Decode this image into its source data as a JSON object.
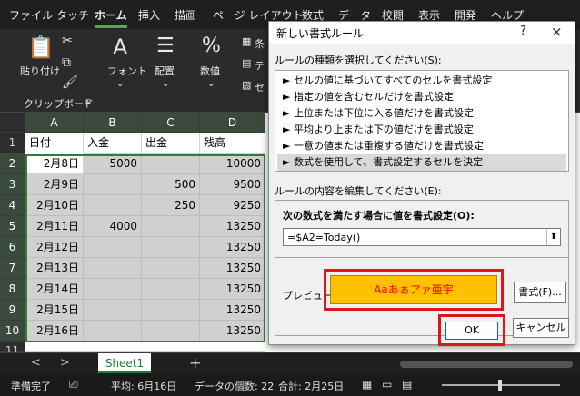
{
  "menu": {
    "tabs": [
      {
        "label": "ファイル",
        "active": false
      },
      {
        "label": "タッチ",
        "active": false
      },
      {
        "label": "ホーム",
        "active": true
      },
      {
        "label": "挿入",
        "active": false
      },
      {
        "label": "描画",
        "active": false
      },
      {
        "label": "ページ レイアウト",
        "active": false
      },
      {
        "label": "数式",
        "active": false
      },
      {
        "label": "データ",
        "active": false
      },
      {
        "label": "校閲",
        "active": false
      },
      {
        "label": "表示",
        "active": false
      },
      {
        "label": "開発",
        "active": false
      },
      {
        "label": "ヘルプ",
        "active": false
      }
    ]
  },
  "ribbon": {
    "paste_label": "貼り付け",
    "clipboard_label": "クリップボード",
    "font_label": "フォント",
    "alignment_label": "配置",
    "number_label": "数値",
    "partial_labels": [
      "条",
      "テ",
      "セ"
    ]
  },
  "grid": {
    "columns": [
      "A",
      "B",
      "C",
      "D"
    ],
    "rows": [
      {
        "num": "1",
        "cells": [
          "日付",
          "入金",
          "出金",
          "残高"
        ]
      },
      {
        "num": "2",
        "cells": [
          "2月8日",
          "5000",
          "",
          "10000"
        ]
      },
      {
        "num": "3",
        "cells": [
          "2月9日",
          "",
          "500",
          "9500"
        ]
      },
      {
        "num": "4",
        "cells": [
          "2月10日",
          "",
          "250",
          "9250"
        ]
      },
      {
        "num": "5",
        "cells": [
          "2月11日",
          "4000",
          "",
          "13250"
        ]
      },
      {
        "num": "6",
        "cells": [
          "2月12日",
          "",
          "",
          "13250"
        ]
      },
      {
        "num": "7",
        "cells": [
          "2月13日",
          "",
          "",
          "13250"
        ]
      },
      {
        "num": "8",
        "cells": [
          "2月14日",
          "",
          "",
          "13250"
        ]
      },
      {
        "num": "9",
        "cells": [
          "2月15日",
          "",
          "",
          "13250"
        ]
      },
      {
        "num": "10",
        "cells": [
          "2月16日",
          "",
          "",
          "13250"
        ]
      },
      {
        "num": "11",
        "cells": [
          "",
          "",
          "",
          ""
        ]
      }
    ]
  },
  "sheet_tabs": {
    "active": "Sheet1",
    "add_symbol": "+",
    "prev_symbol": "<",
    "next_symbol": ">"
  },
  "status": {
    "ready": "準備完了",
    "average": "平均: 6月16日",
    "count": "データの個数: 22",
    "sum": "合計: 2月25日"
  },
  "dialog": {
    "title": "新しい書式ルール",
    "help": "?",
    "close": "×",
    "rule_type_label": "ルールの種類を選択してください(S):",
    "rule_types": [
      {
        "label": "► セルの値に基づいてすべてのセルを書式設定",
        "selected": false
      },
      {
        "label": "► 指定の値を含むセルだけを書式設定",
        "selected": false
      },
      {
        "label": "► 上位または下位に入る値だけを書式設定",
        "selected": false
      },
      {
        "label": "► 平均より上または下の値だけを書式設定",
        "selected": false
      },
      {
        "label": "► 一意の値または重複する値だけを書式設定",
        "selected": false
      },
      {
        "label": "► 数式を使用して、書式設定するセルを決定",
        "selected": true
      }
    ],
    "edit_label": "ルールの内容を編集してください(E):",
    "formula_label": "次の数式を満たす場合に値を書式設定(O):",
    "formula_value": "=$A2=Today()",
    "collapse_symbol": "⬆",
    "preview_label": "プレビュー:",
    "preview_text": "Aaあぁアァ亜宇",
    "format_button": "書式(F)...",
    "ok_button": "OK",
    "cancel_button": "キャンセル",
    "colors": {
      "preview_fill": "#ffc000",
      "preview_text": "#ff0000",
      "highlight": "#e3131e"
    }
  }
}
